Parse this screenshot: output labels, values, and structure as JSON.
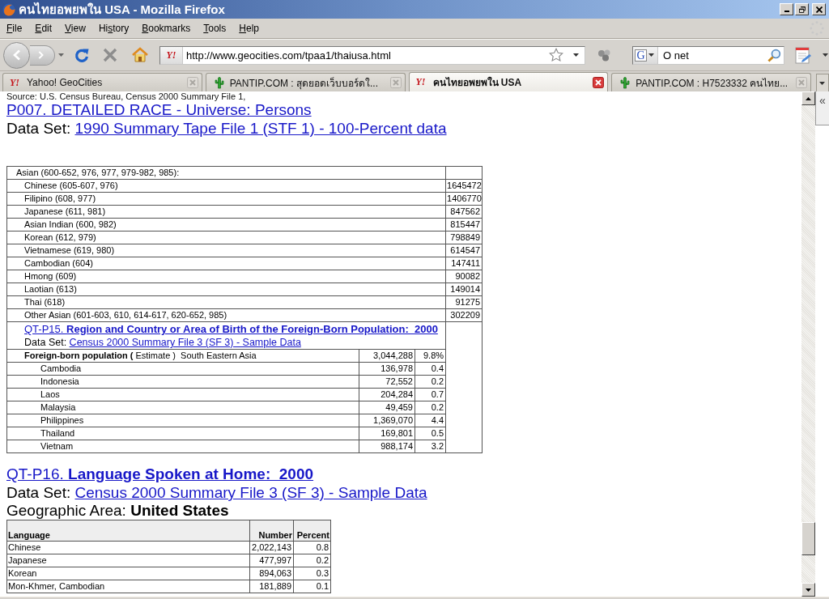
{
  "window": {
    "title": "คนไทยอพยพใน USA - Mozilla Firefox"
  },
  "menu_bar": [
    {
      "key": "F",
      "rest": "ile"
    },
    {
      "key": "E",
      "rest": "dit"
    },
    {
      "key": "V",
      "rest": "iew"
    },
    {
      "pre": "Hi",
      "key": "s",
      "rest": "tory"
    },
    {
      "key": "B",
      "rest": "ookmarks"
    },
    {
      "key": "T",
      "rest": "ools"
    },
    {
      "key": "H",
      "rest": "elp"
    }
  ],
  "nav_toolbar": {
    "url_field": {
      "site_icon": "Y!",
      "value": "http://www.geocities.com/tpaa1/thaiusa.html"
    },
    "search_field": {
      "engine_icon": "G",
      "value": "O net"
    }
  },
  "tabs": [
    {
      "kind": "yahoo",
      "icon": "Y!",
      "label": "Yahoo! GeoCities",
      "selected": false
    },
    {
      "kind": "pantip",
      "label": "PANTIP.COM : สุดยอดเว็บบอร์ดใ...",
      "selected": false
    },
    {
      "kind": "yahoo",
      "icon": "Y!",
      "label": "คนไทยอพยพใน USA",
      "selected": true
    },
    {
      "kind": "pantip",
      "label": "PANTIP.COM : H7523332 คนไทย...",
      "selected": false
    }
  ],
  "sidebar_toggle": "«",
  "page": {
    "source_note": "Source: U.S. Census Bureau, Census 2000 Summary File 1,",
    "p007": {
      "title": "P007. DETAILED RACE - Universe: Persons",
      "dataset_label": "Data Set:",
      "dataset_link": "1990 Summary Tape File 1 (STF 1) - 100-Percent data"
    },
    "race_table": {
      "label": "Asian (600-652, 976, 977, 979-982, 985):",
      "children": [
        {
          "label": "Chinese (605-607, 976)",
          "value": "1645472"
        },
        {
          "label": "Filipino (608, 977)",
          "value": "1406770"
        },
        {
          "label": "Japanese (611, 981)",
          "value": "847562"
        },
        {
          "label": "Asian Indian (600, 982)",
          "value": "815447"
        },
        {
          "label": "Korean (612, 979)",
          "value": "798849"
        },
        {
          "label": "Vietnamese (619, 980)",
          "value": "614547"
        },
        {
          "label": "Cambodian (604)",
          "value": "147411"
        },
        {
          "label": "Hmong (609)",
          "value": "90082"
        },
        {
          "label": "Laotian (613)",
          "value": "149014"
        },
        {
          "label": "Thai (618)",
          "value": "91275"
        },
        {
          "label": "Other Asian (601-603, 610, 614-617, 620-652, 985)",
          "value": "302209"
        }
      ]
    },
    "qt_p15": {
      "title": "QT-P15. **Region and Country or Area of Birth of the Foreign-Born Population:  2000**",
      "dataset_label": "Data Set:",
      "dataset_link": "Census 2000 Summary File 3 (SF 3) - Sample Data",
      "table": {
        "label": "**Foreign-born population (** Estimate )  South Eastern Asia",
        "number": "3,044,288",
        "percent": "9.8%",
        "children": [
          {
            "label": "Cambodia",
            "number": "136,978",
            "percent": "0.4"
          },
          {
            "label": "Indonesia",
            "number": "72,552",
            "percent": "0.2"
          },
          {
            "label": "Laos",
            "number": "204,284",
            "percent": "0.7"
          },
          {
            "label": "Malaysia",
            "number": "49,459",
            "percent": "0.2"
          },
          {
            "label": "Philippines",
            "number": "1,369,070",
            "percent": "4.4"
          },
          {
            "label": "Thailand",
            "number": "169,801",
            "percent": "0.5"
          },
          {
            "label": "Vietnam",
            "number": "988,174",
            "percent": "3.2"
          }
        ]
      }
    },
    "qt_p16": {
      "title": "QT-P16. **Language Spoken at Home:  2000**",
      "dataset_label": "Data Set:",
      "dataset_link": "Census 2000 Summary File 3 (SF 3) - Sample Data",
      "geographic_area": "Geographic Area: **United States**",
      "table": {
        "columns": [
          "Language",
          "Number",
          "Percent"
        ],
        "rows": [
          {
            "language": "Chinese",
            "number": "2,022,143",
            "percent": "0.8"
          },
          {
            "language": "Japanese",
            "number": "477,997",
            "percent": "0.2"
          },
          {
            "language": "Korean",
            "number": "894,063",
            "percent": "0.3"
          },
          {
            "language": "Mon-Khmer, Cambodian",
            "number": "181,889",
            "percent": "0.1"
          }
        ]
      }
    }
  }
}
